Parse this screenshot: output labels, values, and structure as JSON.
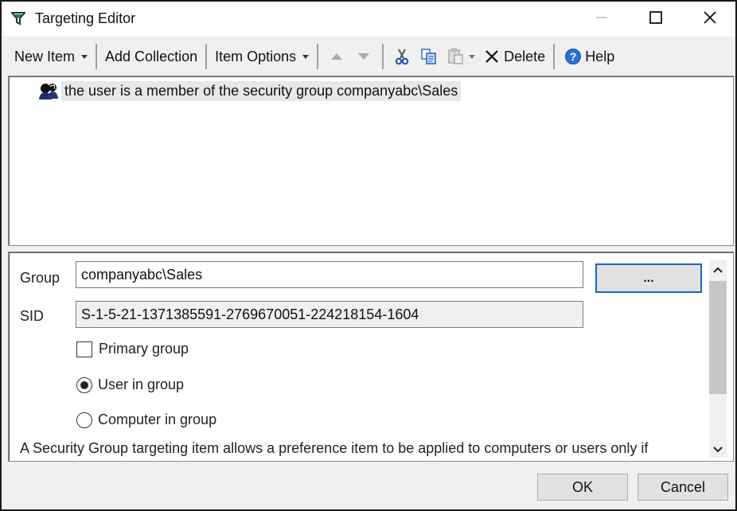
{
  "window": {
    "title": "Targeting Editor",
    "icon": "filter-funnel-icon",
    "controls": [
      "minimize",
      "maximize",
      "close"
    ]
  },
  "toolbar": {
    "new_item_label": "New Item",
    "add_collection_label": "Add Collection",
    "item_options_label": "Item Options",
    "move_up_icon": "arrow-up-icon",
    "move_down_icon": "arrow-down-icon",
    "cut_icon": "scissors-icon",
    "copy_icon": "copy-icon",
    "paste_icon": "paste-icon",
    "delete_label": "Delete",
    "help_label": "Help"
  },
  "tree": {
    "items": [
      {
        "label": "the user is a member of the security group companyabc\\Sales",
        "icon": "security-group-users-icon",
        "selected": true
      }
    ]
  },
  "properties": {
    "group_label": "Group",
    "group_value": "companyabc\\Sales",
    "browse_label": "...",
    "sid_label": "SID",
    "sid_value": "S-1-5-21-1371385591-2769670051-224218154-1604",
    "primary_group_label": "Primary group",
    "primary_group_checked": false,
    "user_in_group_label": "User in group",
    "user_in_group_selected": true,
    "computer_in_group_label": "Computer in group",
    "computer_in_group_selected": false,
    "description": "A Security Group targeting item allows a preference item to be applied to computers or users only if"
  },
  "buttons": {
    "ok_label": "OK",
    "cancel_label": "Cancel"
  },
  "colors": {
    "focus_border": "#1565c0",
    "funnel_icon": "#1a7a6e"
  }
}
